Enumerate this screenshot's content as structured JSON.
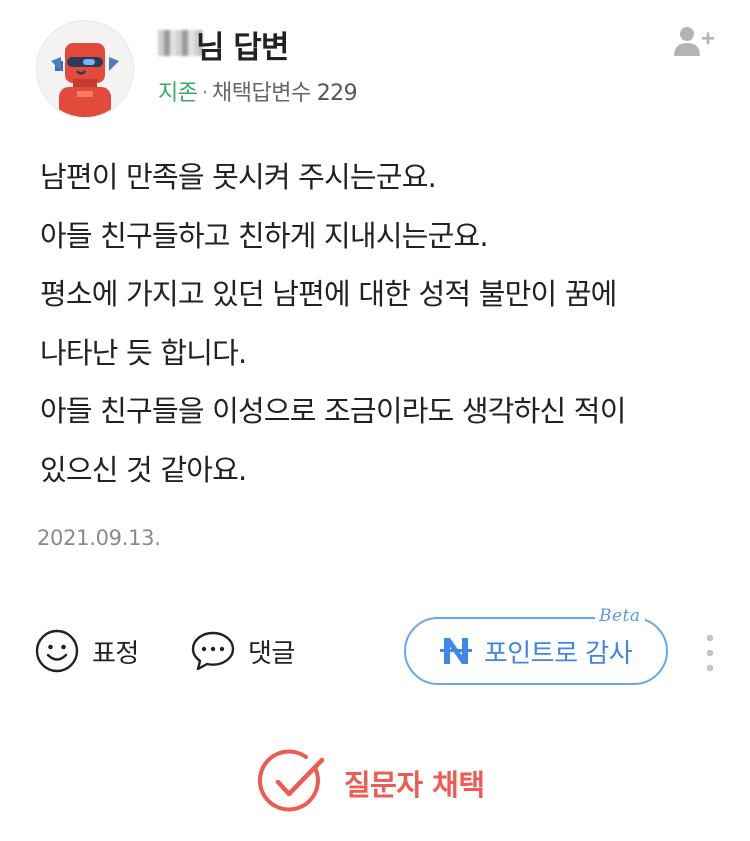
{
  "answerer": {
    "name_suffix": "님 답변",
    "grade": "지존",
    "separator": "·",
    "adopt_label": "채택답변수",
    "adopt_count": "229"
  },
  "answer": {
    "lines": [
      "남편이 만족을 못시켜 주시는군요.",
      "아들 친구들하고 친하게 지내시는군요.",
      "평소에 가지고 있던 남편에 대한 성적 불만이 꿈에",
      "나타난 듯 합니다.",
      "아들 친구들을 이성으로 조금이라도 생각하신 적이",
      "있으신 것 같아요."
    ],
    "date": "2021.09.13."
  },
  "actions": {
    "emoji_label": "표정",
    "comment_label": "댓글",
    "point_label": "포인트로 감사",
    "beta_label": "Beta"
  },
  "select": {
    "label": "질문자 채택"
  },
  "colors": {
    "grade_green": "#3aa96b",
    "point_blue": "#3f86e8",
    "select_red": "#ef5a52"
  }
}
